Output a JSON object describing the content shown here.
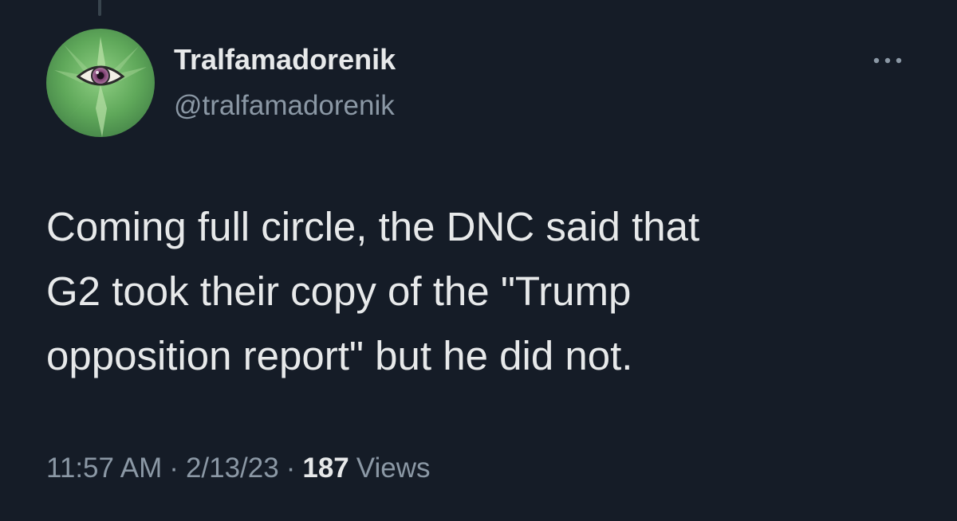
{
  "author": {
    "display_name": "Tralfamadorenik",
    "handle": "@tralfamadorenik",
    "avatar_icon": "eye-leaf-avatar"
  },
  "menu": {
    "icon": "more-options-icon"
  },
  "tweet": {
    "text": "Coming full circle, the DNC said that\nG2 took their copy of the \"Trump\nopposition report\" but he did not.",
    "time": "11:57 AM",
    "separator": "·",
    "date": "2/13/23",
    "views_count": "187",
    "views_label": "Views"
  },
  "colors": {
    "background": "#151c27",
    "text_primary": "#e7e9ea",
    "text_secondary": "#8b98a5",
    "avatar_green": "#5fa85a"
  }
}
